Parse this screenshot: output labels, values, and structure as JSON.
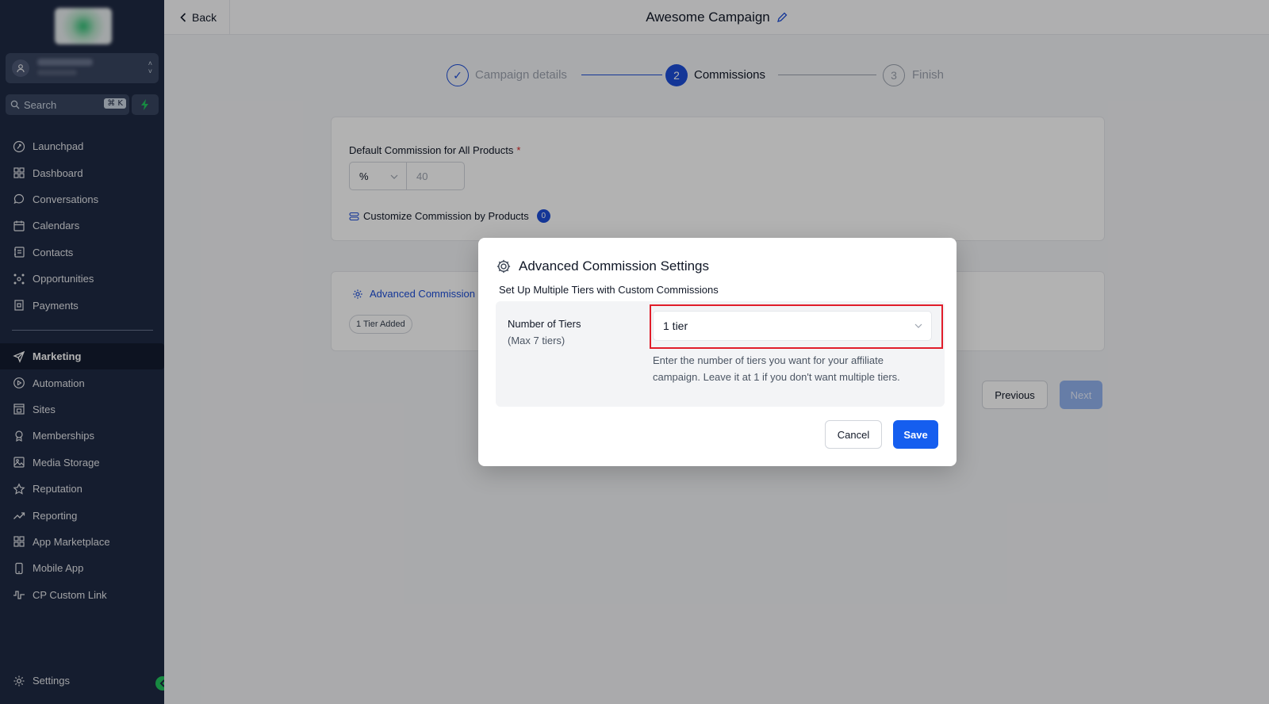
{
  "sidebar": {
    "search": {
      "placeholder": "Search",
      "shortcut": "⌘ K"
    },
    "items": [
      {
        "label": "Launchpad",
        "icon": "rocket-icon"
      },
      {
        "label": "Dashboard",
        "icon": "grid-icon"
      },
      {
        "label": "Conversations",
        "icon": "chat-icon"
      },
      {
        "label": "Calendars",
        "icon": "calendar-icon"
      },
      {
        "label": "Contacts",
        "icon": "contacts-icon"
      },
      {
        "label": "Opportunities",
        "icon": "network-icon"
      },
      {
        "label": "Payments",
        "icon": "receipt-icon"
      }
    ],
    "items2": [
      {
        "label": "Marketing",
        "icon": "send-icon",
        "active": true
      },
      {
        "label": "Automation",
        "icon": "play-circle-icon"
      },
      {
        "label": "Sites",
        "icon": "browser-icon"
      },
      {
        "label": "Memberships",
        "icon": "badge-icon"
      },
      {
        "label": "Media Storage",
        "icon": "image-icon"
      },
      {
        "label": "Reputation",
        "icon": "star-icon"
      },
      {
        "label": "Reporting",
        "icon": "trend-icon"
      },
      {
        "label": "App Marketplace",
        "icon": "apps-icon"
      },
      {
        "label": "Mobile App",
        "icon": "phone-icon"
      },
      {
        "label": "CP Custom Link",
        "icon": "pulse-icon"
      }
    ],
    "settings_label": "Settings"
  },
  "topbar": {
    "back_label": "Back",
    "title": "Awesome Campaign"
  },
  "stepper": {
    "steps": [
      {
        "num": "✓",
        "label": "Campaign details",
        "state": "done"
      },
      {
        "num": "2",
        "label": "Commissions",
        "state": "active"
      },
      {
        "num": "3",
        "label": "Finish",
        "state": "pending"
      }
    ]
  },
  "commission": {
    "label": "Default Commission for All Products",
    "required": "*",
    "unit": "%",
    "value": "40",
    "customize_label": "Customize Commission by Products",
    "customize_count": "0"
  },
  "advanced_card": {
    "link_label": "Advanced Commission",
    "chip": "1 Tier Added"
  },
  "nav_buttons": {
    "previous": "Previous",
    "next": "Next"
  },
  "modal": {
    "title": "Advanced Commission Settings",
    "subtitle": "Set Up Multiple Tiers with Custom Commissions",
    "tiers_label": "Number of Tiers",
    "tiers_hint": "(Max 7 tiers)",
    "tiers_value": "1 tier",
    "help": "Enter the number of tiers you want for your affiliate campaign. Leave it at 1 if you don't want multiple tiers.",
    "cancel": "Cancel",
    "save": "Save"
  },
  "colors": {
    "sidebar_bg": "#1f2a44",
    "accent": "#1d4ed8",
    "highlight": "#e11d2a"
  }
}
